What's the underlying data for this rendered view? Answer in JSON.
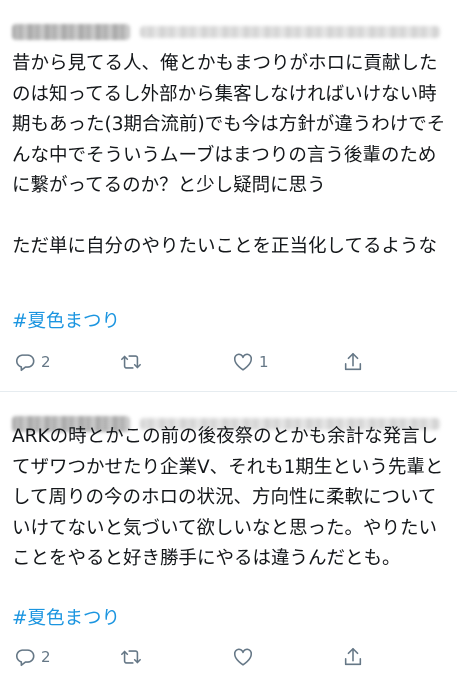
{
  "tweets": [
    {
      "author_name": "",
      "author_handle": "",
      "text": "昔から見てる人、俺とかもまつりがホロに貢献したのは知ってるし外部から集客しなければいけない時期もあった(3期合流前)でも今は方針が違うわけでそんな中でそういうムーブはまつりの言う後輩のために繋がってるのか？と少し疑問に思う\n\nただ単に自分のやりたいことを正当化してるような",
      "hashtag": "#夏色まつり",
      "reply_count": "2",
      "retweet_count": "",
      "like_count": "1"
    },
    {
      "author_name": "",
      "author_handle": "",
      "text": "ARKの時とかこの前の後夜祭のとかも余計な発言してザワつかせたり企業V、それも1期生という先輩として周りの今のホロの状況、方向性に柔軟についていけてないと気づいて欲しいなと思った。やりたいことをやると好き勝手にやるは違うんだとも。",
      "hashtag": "#夏色まつり",
      "reply_count": "2",
      "retweet_count": "",
      "like_count": ""
    }
  ],
  "icons": {
    "reply": "reply-icon",
    "retweet": "retweet-icon",
    "like": "heart-icon",
    "share": "share-icon"
  },
  "colors": {
    "text": "#14171a",
    "hashtag": "#1b95e0",
    "action_gray": "#657786",
    "divider": "#e6ecf0"
  }
}
